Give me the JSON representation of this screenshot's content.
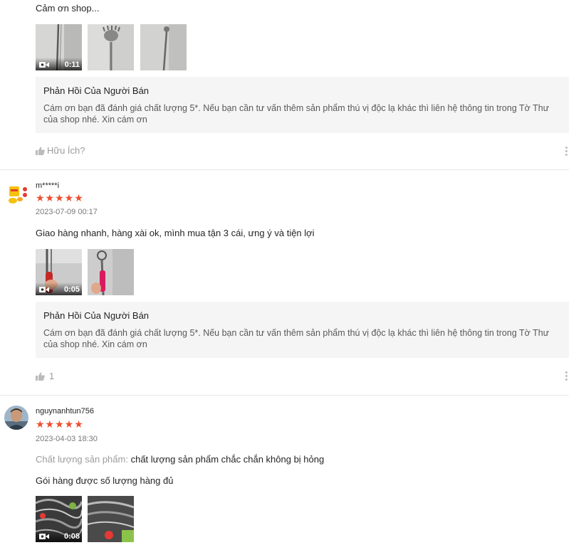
{
  "review1": {
    "content_tail": "Cảm ơn shop...",
    "media": [
      {
        "type": "video",
        "duration": "0:11"
      },
      {
        "type": "image"
      },
      {
        "type": "image"
      }
    ],
    "reply_title": "Phản Hồi Của Người Bán",
    "reply_text": "Cám ơn bạn đã đánh giá chất lượng 5*. Nếu bạn cần tư vấn thêm sản phẩm thú vị độc lạ khác thì liên hệ thông tin trong Tờ Thư của shop nhé. Xin cám ơn",
    "helpful_label": "Hữu Ích?"
  },
  "review2": {
    "username": "m*****i",
    "stars": "★★★★★",
    "rating": 5,
    "date": "2023-07-09 00:17",
    "content": "Giao hàng nhanh, hàng xài ok, mình mua tận 3 cái, ưng ý và tiện lợi",
    "media": [
      {
        "type": "video",
        "duration": "0:05"
      },
      {
        "type": "image"
      }
    ],
    "reply_title": "Phản Hồi Của Người Bán",
    "reply_text": "Cám ơn bạn đã đánh giá chất lượng 5*. Nếu bạn cần tư vấn thêm sản phẩm thú vị độc lạ khác thì liên hệ thông tin trong Tờ Thư của shop nhé. Xin cám ơn",
    "helpful_count": "1"
  },
  "review3": {
    "username": "nguynanhtun756",
    "stars": "★★★★★",
    "rating": 5,
    "date": "2023-04-03 18:30",
    "quality_label": "Chất lượng sản phẩm:",
    "quality_value": "chất lượng sản phẩm chắc chắn không bị hỏng",
    "content": "Gói hàng được số lượng hàng đủ",
    "media": [
      {
        "type": "video",
        "duration": "0:08"
      },
      {
        "type": "image"
      }
    ]
  },
  "colors": {
    "star": "#ee4d2d",
    "reply_bg": "#f5f5f5",
    "separator": "#e8e8e8"
  },
  "icons": {
    "helpful": "thumbs-up-icon",
    "video": "video-camera-icon",
    "more": "more-vertical-icon"
  }
}
